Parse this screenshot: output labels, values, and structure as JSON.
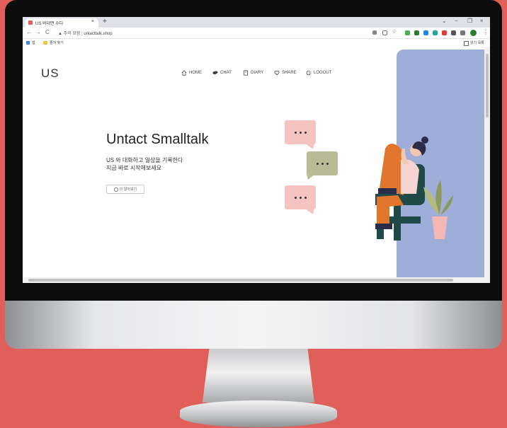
{
  "browser": {
    "tab_title": "US 비대면 수다",
    "tab_close": "×",
    "new_tab": "+",
    "window_controls": [
      "⌄",
      "−",
      "❐",
      "×"
    ],
    "nav": [
      "←",
      "→",
      "C"
    ],
    "security_warning": "▲ 주의 요함",
    "url": "untacttalk.shop",
    "bookmarks": [
      "앱",
      "즐겨 찾기"
    ],
    "reading_list": "읽기 목록"
  },
  "site": {
    "logo": "US",
    "menu": [
      {
        "label": "HOME",
        "icon": "home-icon"
      },
      {
        "label": "CHAT",
        "icon": "chat-icon"
      },
      {
        "label": "DIARY",
        "icon": "diary-icon"
      },
      {
        "label": "SHARE",
        "icon": "heart-icon"
      },
      {
        "label": "LOGOUT",
        "icon": "logout-icon"
      }
    ],
    "hero": {
      "title": "Untact Smalltalk",
      "subtitle_line1": "US 와 대화하고 일상을 기록한다",
      "subtitle_line2": "지금 바로 시작해보세요",
      "button_label": "더 알아보기"
    }
  },
  "colors": {
    "background": "#e05f59",
    "sidebar": "#9fadd9",
    "bubble_pink": "#f5c3c0",
    "bubble_green": "#b8bb96",
    "figure_orange": "#e2752c",
    "figure_teal": "#1f4a48",
    "figure_shirt": "#f4d3d1"
  }
}
